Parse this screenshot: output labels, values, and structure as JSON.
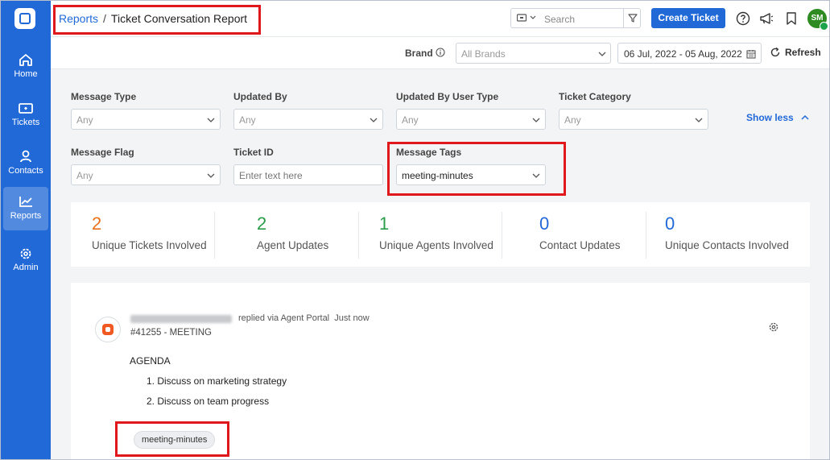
{
  "sidebar": {
    "items": [
      {
        "label": "Home",
        "icon": "home-icon"
      },
      {
        "label": "Tickets",
        "icon": "ticket-icon"
      },
      {
        "label": "Contacts",
        "icon": "person-icon"
      },
      {
        "label": "Reports",
        "icon": "chart-icon",
        "active": true
      },
      {
        "label": "Admin",
        "icon": "gear-icon"
      }
    ]
  },
  "header": {
    "breadcrumb_link": "Reports",
    "breadcrumb_sep": "/",
    "page_title": "Ticket Conversation Report",
    "search_placeholder": "Search",
    "create_button": "Create Ticket",
    "avatar_initials": "SM"
  },
  "toolbar": {
    "brand_label": "Brand",
    "brand_value": "All Brands",
    "date_range": "06 Jul, 2022 - 05 Aug, 2022",
    "refresh_label": "Refresh"
  },
  "filters": {
    "message_type": {
      "label": "Message Type",
      "value": "Any"
    },
    "updated_by": {
      "label": "Updated By",
      "value": "Any"
    },
    "updated_by_user_type": {
      "label": "Updated By User Type",
      "value": "Any"
    },
    "ticket_category": {
      "label": "Ticket Category",
      "value": "Any"
    },
    "message_flag": {
      "label": "Message Flag",
      "value": "Any"
    },
    "ticket_id": {
      "label": "Ticket ID",
      "placeholder": "Enter text here"
    },
    "message_tags": {
      "label": "Message Tags",
      "value": "meeting-minutes"
    },
    "show_less": "Show less"
  },
  "stats": [
    {
      "value": "2",
      "label": "Unique Tickets Involved",
      "color": "#e8711a"
    },
    {
      "value": "2",
      "label": "Agent Updates",
      "color": "#2a9d4a"
    },
    {
      "value": "1",
      "label": "Unique Agents Involved",
      "color": "#2a9d4a"
    },
    {
      "value": "0",
      "label": "Contact Updates",
      "color": "#2269d8"
    },
    {
      "value": "0",
      "label": "Unique Contacts Involved",
      "color": "#2269d8"
    }
  ],
  "conversation": {
    "meta_channel": "replied via Agent Portal",
    "meta_time": "Just now",
    "ticket_ref": "#41255 - MEETING",
    "agenda_title": "AGENDA",
    "agenda_items": [
      "1. Discuss on marketing strategy",
      "2. Discuss on team progress"
    ],
    "tag": "meeting-minutes"
  },
  "colors": {
    "accent": "#2269d8",
    "highlight": "#e0181b"
  }
}
